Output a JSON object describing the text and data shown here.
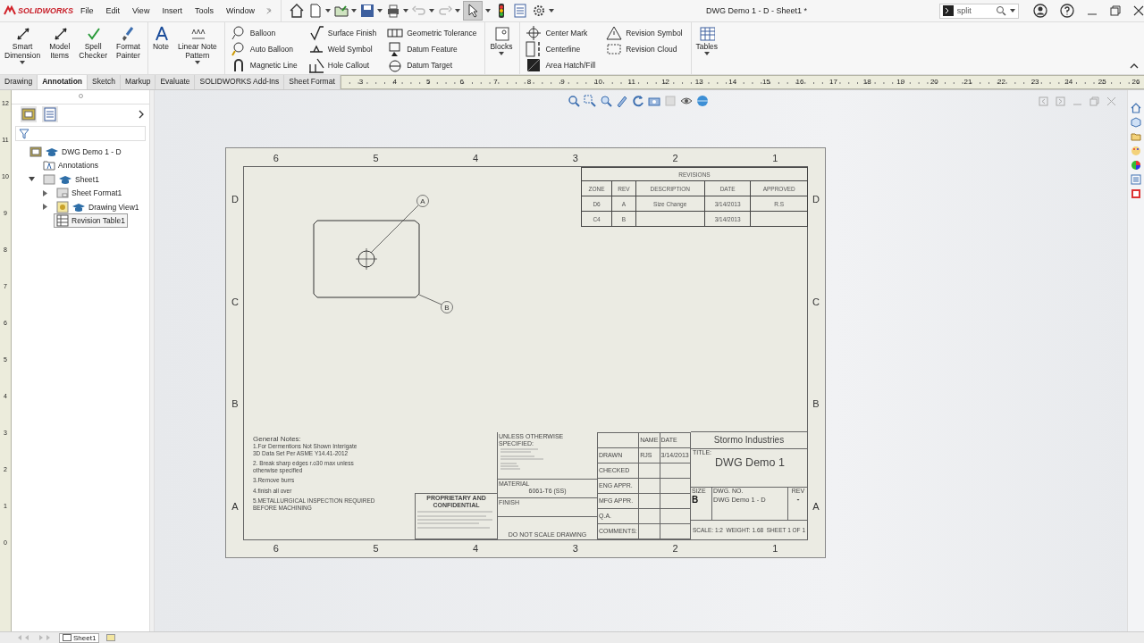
{
  "app": {
    "logo": "SOLIDWORKS",
    "menus": [
      "File",
      "Edit",
      "View",
      "Insert",
      "Tools",
      "Window"
    ],
    "title": "DWG Demo 1 - D - Sheet1 *",
    "search": {
      "value": "split"
    }
  },
  "ribbon": [
    {
      "kind": "large",
      "label": "Smart\nDimension",
      "dropdown": true
    },
    {
      "kind": "large",
      "label": "Model\nItems",
      "dropdown": false
    },
    {
      "kind": "large",
      "label": "Spell\nChecker",
      "dropdown": false
    },
    {
      "kind": "large",
      "label": "Format\nPainter",
      "dropdown": false
    },
    {
      "kind": "large",
      "label": "Note",
      "dropdown": false
    },
    {
      "kind": "large",
      "label": "Linear Note\nPattern",
      "dropdown": true
    },
    {
      "kind": "stack",
      "items": [
        "Balloon",
        "Auto Balloon",
        "Magnetic Line"
      ]
    },
    {
      "kind": "stack",
      "items": [
        "Surface Finish",
        "Weld Symbol",
        "Hole Callout"
      ]
    },
    {
      "kind": "stack",
      "items": [
        "Geometric Tolerance",
        "Datum Feature",
        "Datum Target"
      ]
    },
    {
      "kind": "large",
      "label": "Blocks",
      "dropdown": true
    },
    {
      "kind": "stack",
      "items": [
        "Center Mark",
        "Centerline",
        "Area Hatch/Fill"
      ]
    },
    {
      "kind": "stack",
      "items": [
        "Revision Symbol",
        "Revision Cloud"
      ]
    },
    {
      "kind": "large",
      "label": "Tables",
      "dropdown": true
    }
  ],
  "tabs": [
    {
      "label": "Drawing",
      "selected": false
    },
    {
      "label": "Annotation",
      "selected": true
    },
    {
      "label": "Sketch",
      "selected": false
    },
    {
      "label": "Markup",
      "selected": false
    },
    {
      "label": "Evaluate",
      "selected": false
    },
    {
      "label": "SOLIDWORKS Add-Ins",
      "selected": false
    },
    {
      "label": "Sheet Format",
      "selected": false
    }
  ],
  "ruler": {
    "horizontal": [
      "3",
      "4",
      "5",
      "6",
      "7",
      "8",
      "9",
      "10",
      "11",
      "12",
      "13",
      "14",
      "15",
      "16",
      "17",
      "18",
      "19",
      "20",
      "21",
      "22",
      "23",
      "24",
      "25",
      "26"
    ],
    "vertical": [
      "12",
      "11",
      "10",
      "9",
      "8",
      "7",
      "6",
      "5",
      "4",
      "3",
      "2",
      "1",
      "0"
    ]
  },
  "tree": {
    "root": {
      "label": "DWG Demo 1 - D",
      "children": [
        {
          "label": "Annotations",
          "kind": "annotations",
          "selected": false
        },
        {
          "label": "Sheet1",
          "kind": "sheet",
          "expanded": true,
          "selected": false,
          "children": [
            {
              "label": "Sheet Format1",
              "kind": "format",
              "expanded": false,
              "selected": false
            },
            {
              "label": "Drawing View1",
              "kind": "view",
              "expanded": false,
              "selected": false
            },
            {
              "label": "Revision Table1",
              "kind": "table",
              "selected": true
            }
          ]
        }
      ]
    }
  },
  "sheet": {
    "top_numbers": [
      "6",
      "5",
      "4",
      "3",
      "2",
      "1"
    ],
    "bottom_numbers": [
      "6",
      "5",
      "4",
      "3",
      "2",
      "1"
    ],
    "left_letters": [
      "D",
      "C",
      "B",
      "A"
    ],
    "right_letters": [
      "D",
      "C",
      "B",
      "A"
    ],
    "balloons": [
      "A",
      "B"
    ],
    "revision_table": {
      "title": "REVISIONS",
      "columns": [
        "ZONE",
        "REV",
        "DESCRIPTION",
        "DATE",
        "APPROVED"
      ],
      "rows": [
        [
          "D6",
          "A",
          "Size Change",
          "3/14/2013",
          "R.S"
        ],
        [
          "C4",
          "B",
          null,
          "3/14/2013",
          null
        ]
      ]
    },
    "notes": {
      "title": "General Notes:",
      "items": [
        "1.For Dermentions Not Shown Interigate\n 3D Data Set Per ASME Y14.41-2012",
        "2. Break sharp edges r.o30 max unless\notherwise specified",
        "3.Remove burrs",
        "4.finish all over",
        "5.METALLURGICAL INSPECTION REQUIRED\nBEFORE MACHINING"
      ]
    },
    "title_block": {
      "proprietary": "PROPRIETARY AND CONFIDENTIAL",
      "tolerance_heading": "UNLESS OTHERWISE SPECIFIED:",
      "material_label": "MATERIAL",
      "material": "6061-T6 (SS)",
      "finish_label": "FINISH",
      "do_not_scale": "DO NOT SCALE DRAWING",
      "sign_headers": [
        "NAME",
        "DATE"
      ],
      "sign_rows": [
        [
          "DRAWN",
          "RJS",
          "3/14/2013"
        ],
        [
          "CHECKED",
          null,
          null
        ],
        [
          "ENG APPR.",
          null,
          null
        ],
        [
          "MFG APPR.",
          null,
          null
        ],
        [
          "Q.A.",
          null,
          null
        ],
        [
          "COMMENTS:",
          null,
          null
        ]
      ],
      "company": "Stormo Industries",
      "title_label": "TITLE:",
      "title": "DWG Demo 1",
      "size_label": "SIZE",
      "size": "B",
      "dwg_no_label": "DWG.  NO.",
      "dwg_no": "DWG Demo 1 - D",
      "rev_label": "REV",
      "rev": "-",
      "scale": "SCALE: 1:2",
      "weight": "WEIGHT: 1.68",
      "sheet": "SHEET 1 OF 1"
    }
  },
  "status_bar": {
    "tabs": [
      {
        "label": "Sheet1",
        "selected": true
      }
    ]
  }
}
